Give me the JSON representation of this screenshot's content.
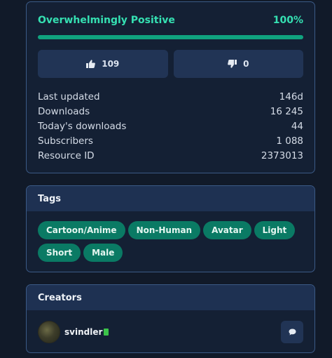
{
  "rating": {
    "label": "Overwhelmingly Positive",
    "percent_text": "100%",
    "percent_value": 100,
    "upvotes": "109",
    "downvotes": "0"
  },
  "stats": [
    {
      "label": "Last updated",
      "value": "146d"
    },
    {
      "label": "Downloads",
      "value": "16 245"
    },
    {
      "label": "Today's downloads",
      "value": "44"
    },
    {
      "label": "Subscribers",
      "value": "1 088"
    },
    {
      "label": "Resource ID",
      "value": "2373013"
    }
  ],
  "tags": {
    "title": "Tags",
    "items": [
      "Cartoon/Anime",
      "Non-Human",
      "Avatar",
      "Light",
      "Short",
      "Male"
    ]
  },
  "creators": {
    "title": "Creators",
    "items": [
      {
        "name": "svindler"
      }
    ]
  },
  "icons": {
    "upvote": "thumbs-up-icon",
    "downvote": "thumbs-down-icon",
    "message": "chat-bubble-icon",
    "badge": "green-badge-icon"
  },
  "colors": {
    "accent": "#35e0b2",
    "tag_bg": "#0a7a64",
    "card_border": "#3b5a86"
  }
}
